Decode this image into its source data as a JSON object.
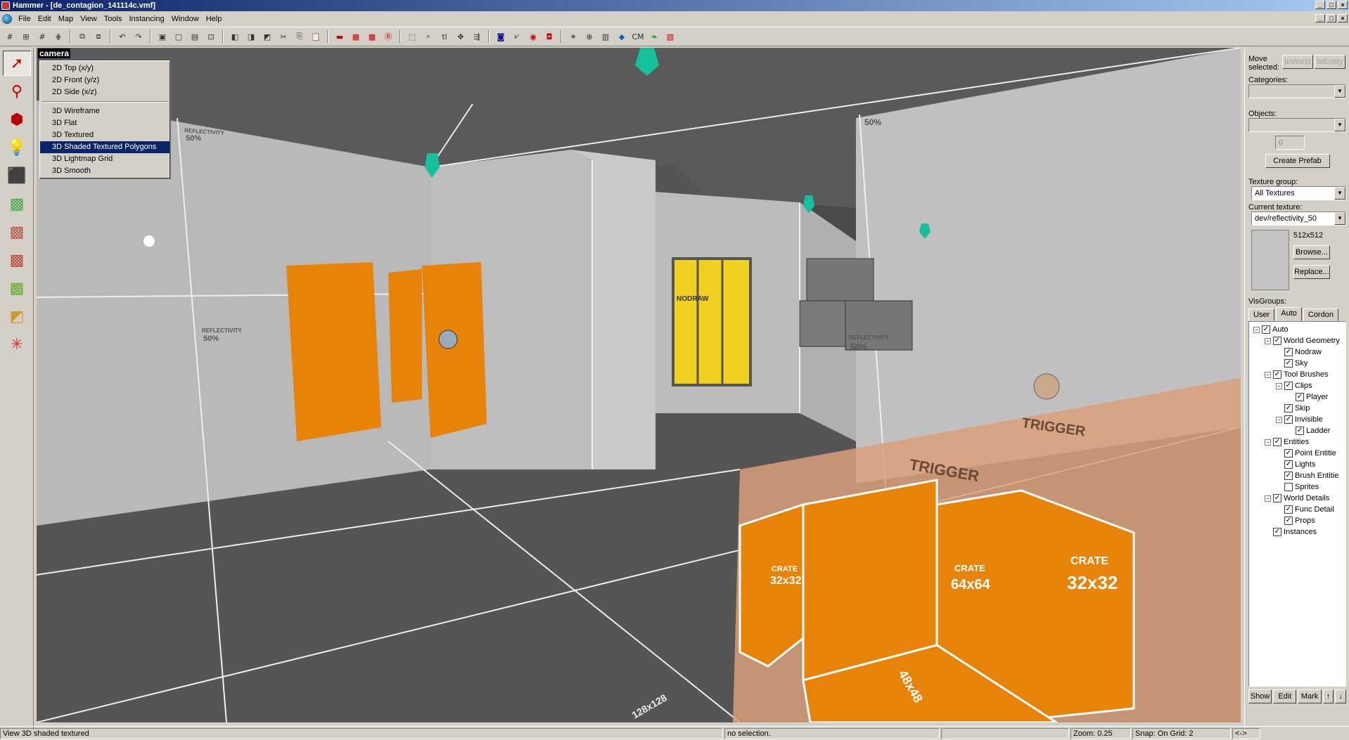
{
  "window": {
    "title": "Hammer - [de_contagion_141114c.vmf]"
  },
  "menu": [
    "File",
    "Edit",
    "Map",
    "View",
    "Tools",
    "Instancing",
    "Window",
    "Help"
  ],
  "viewport": {
    "camera_label": "camera",
    "view_menu": {
      "items": [
        "2D Top (x/y)",
        "2D Front (y/z)",
        "2D Side (x/z)",
        "3D Wireframe",
        "3D Flat",
        "3D Textured",
        "3D Shaded Textured Polygons",
        "3D Lightmap Grid",
        "3D Smooth"
      ],
      "selected": "3D Shaded Textured Polygons"
    },
    "texture_labels": {
      "reflectivity": "REFLECTIVITY",
      "percent": "50%",
      "trigger": "TRIGGER",
      "nodraw": "NODRAW",
      "crate": "CRATE",
      "crate_size_a": "32x32",
      "crate_size_b": "64x64",
      "crate_size_c": "48x48",
      "grid_size": "128x128"
    }
  },
  "right_panel": {
    "move_selected_label": "Move selected:",
    "to_world": "toWorld",
    "to_entity": "toEntity",
    "categories_label": "Categories:",
    "objects_label": "Objects:",
    "spinner_value": "0",
    "create_prefab": "Create Prefab",
    "texture_group_label": "Texture group:",
    "texture_group": "All Textures",
    "current_texture_label": "Current texture:",
    "current_texture": "dev/reflectivity_50",
    "texture_size": "512x512",
    "browse": "Browse...",
    "replace": "Replace...",
    "visgroups_label": "VisGroups:",
    "tabs": [
      "User",
      "Auto",
      "Cordon"
    ],
    "active_tab": "Auto",
    "tree": [
      {
        "label": "Auto",
        "level": 0,
        "expand": "−",
        "checked": true
      },
      {
        "label": "World Geometry",
        "level": 1,
        "expand": "−",
        "checked": true
      },
      {
        "label": "Nodraw",
        "level": 2,
        "expand": "",
        "checked": true
      },
      {
        "label": "Sky",
        "level": 2,
        "expand": "",
        "checked": true
      },
      {
        "label": "Tool Brushes",
        "level": 1,
        "expand": "−",
        "checked": true
      },
      {
        "label": "Clips",
        "level": 2,
        "expand": "−",
        "checked": true
      },
      {
        "label": "Player",
        "level": 3,
        "expand": "",
        "checked": true
      },
      {
        "label": "Skip",
        "level": 2,
        "expand": "",
        "checked": true
      },
      {
        "label": "Invisible",
        "level": 2,
        "expand": "−",
        "checked": true
      },
      {
        "label": "Ladder",
        "level": 3,
        "expand": "",
        "checked": true
      },
      {
        "label": "Entities",
        "level": 1,
        "expand": "−",
        "checked": true
      },
      {
        "label": "Point Entitie",
        "level": 2,
        "expand": "",
        "checked": true
      },
      {
        "label": "Lights",
        "level": 2,
        "expand": "",
        "checked": true
      },
      {
        "label": "Brush Entitie",
        "level": 2,
        "expand": "",
        "checked": true
      },
      {
        "label": "Sprites",
        "level": 2,
        "expand": "",
        "checked": false
      },
      {
        "label": "World Details",
        "level": 1,
        "expand": "−",
        "checked": true
      },
      {
        "label": "Func Detail",
        "level": 2,
        "expand": "",
        "checked": true
      },
      {
        "label": "Props",
        "level": 2,
        "expand": "",
        "checked": true
      },
      {
        "label": "Instances",
        "level": 1,
        "expand": "",
        "checked": true
      }
    ],
    "show": "Show",
    "edit": "Edit",
    "mark": "Mark"
  },
  "status": {
    "help": "View 3D shaded textured",
    "selection": "no selection.",
    "zoom": "Zoom: 0.25",
    "snap": "Snap: On Grid: 2",
    "arrows": "<->"
  }
}
